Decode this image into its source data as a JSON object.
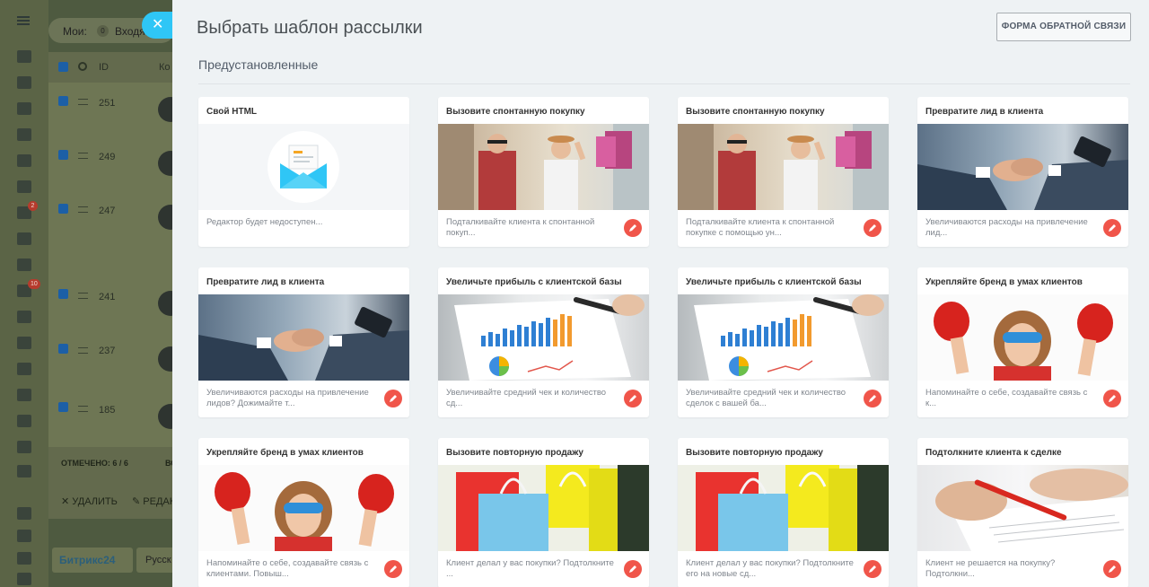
{
  "background": {
    "tabs": {
      "my_label": "Мои:",
      "my_count": "0",
      "incoming_label": "Входяш"
    },
    "table": {
      "id_header": "ID",
      "col2_header": "Ко",
      "rows": [
        "251",
        "249",
        "247",
        "241",
        "237",
        "185"
      ]
    },
    "footer": {
      "marked_label": "ОТМЕЧЕНО: 6 / 6",
      "marked_extra": "ВС",
      "delete_label": "УДАЛИТЬ",
      "edit_label": "РЕДАКТ"
    },
    "bottom": {
      "logo": "Битрикс24",
      "language": "Русск"
    },
    "rail_badges": {
      "mail": "2",
      "filter": "10"
    }
  },
  "panel": {
    "close_label": "✕",
    "title": "Выбрать шаблон рассылки",
    "feedback_button": "ФОРМА ОБРАТНОЙ СВЯЗИ",
    "section_title": "Предустановленные",
    "cards": [
      {
        "title": "Свой HTML",
        "desc": "Редактор будет недоступен...",
        "image": "html"
      },
      {
        "title": "Вызовите спонтанную покупку",
        "desc": "Подталкивайте клиента к спонтанной покуп...",
        "image": "shop"
      },
      {
        "title": "Вызовите спонтанную покупку",
        "desc": "Подталкивайте клиента к спонтанной покупке с помощью ун...",
        "image": "shop"
      },
      {
        "title": "Превратите лид в клиента",
        "desc": "Увеличиваются расходы на привлечение лид...",
        "image": "hand"
      },
      {
        "title": "Превратите лид в клиента",
        "desc": "Увеличиваются расходы на привлечение лидов? Дожимайте т...",
        "image": "hand"
      },
      {
        "title": "Увеличьте прибыль с клиентской базы",
        "desc": "Увеличивайте средний чек и количество сд...",
        "image": "chart"
      },
      {
        "title": "Увеличьте прибыль с клиентской базы",
        "desc": "Увеличивайте средний чек и количество сделок с вашей ба...",
        "image": "chart"
      },
      {
        "title": "Укрепляйте бренд в умах клиентов",
        "desc": "Напоминайте о себе, создавайте связь с к...",
        "image": "kid"
      },
      {
        "title": "Укрепляйте бренд в умах клиентов",
        "desc": "Напоминайте о себе, создавайте связь с клиентами. Повыш...",
        "image": "kid"
      },
      {
        "title": "Вызовите повторную продажу",
        "desc": "Клиент делал у вас покупки? Подтолкните ...",
        "image": "bags"
      },
      {
        "title": "Вызовите повторную продажу",
        "desc": "Клиент делал у вас покупки? Подтолкните его на новые сд...",
        "image": "bags"
      },
      {
        "title": "Подтолкните клиента к сделке",
        "desc": "Клиент не решается на покупку? Подтолкни...",
        "image": "pen"
      }
    ]
  }
}
